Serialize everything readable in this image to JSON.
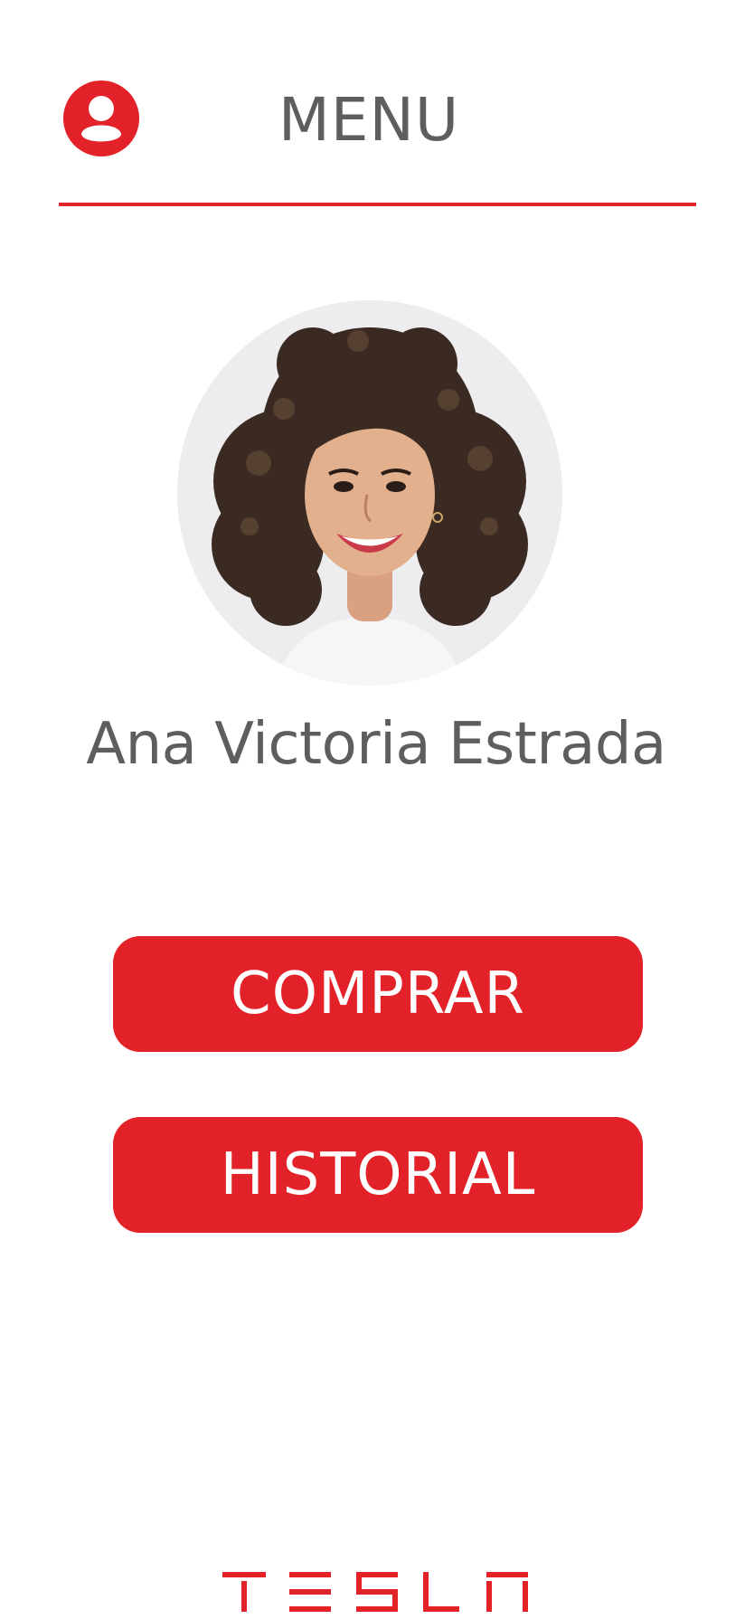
{
  "header": {
    "title": "MENU",
    "profile_icon": "user-circle-icon"
  },
  "profile": {
    "name": "Ana Victoria Estrada",
    "photo": "profile-photo"
  },
  "actions": {
    "buy_label": "COMPRAR",
    "history_label": "HISTORIAL"
  },
  "footer": {
    "logo_text": "TESLA",
    "logo": "tesla-logo"
  },
  "colors": {
    "accent": "#e22128",
    "text": "#5e5e5e",
    "background": "#ffffff"
  }
}
